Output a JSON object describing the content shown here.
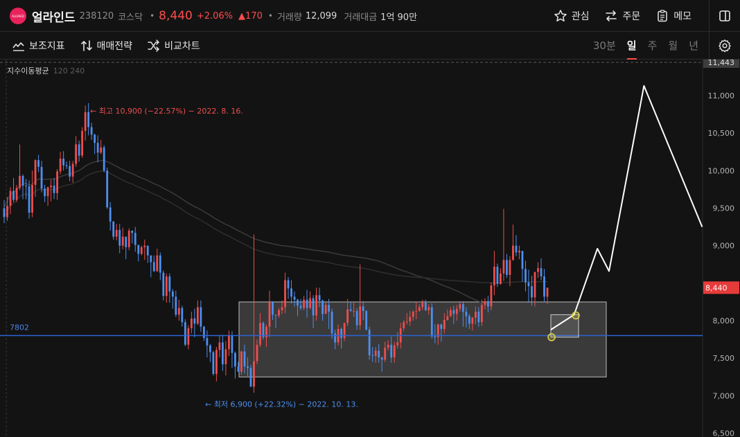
{
  "header": {
    "logo_text": "ALIGNED",
    "name": "얼라인드",
    "code": "238120",
    "market": "코스닥",
    "price": "8,440",
    "change_pct": "+2.06%",
    "change_abs": "▲170",
    "volume_label": "거래량",
    "volume": "12,099",
    "amount_label": "거래대금",
    "amount": "1억 90만",
    "buttons": {
      "watch": "관심",
      "order": "주문",
      "memo": "메모"
    }
  },
  "toolbar": {
    "tools": [
      "보조지표",
      "매매전략",
      "비교차트"
    ],
    "periods": [
      "30분",
      "일",
      "주",
      "월",
      "년"
    ],
    "active_period": "일"
  },
  "indicator": {
    "name": "지수이동평균",
    "params": "120 240"
  },
  "chart_data": {
    "type": "candlestick",
    "y_ticks": [
      "11,000",
      "10,500",
      "10,000",
      "9,500",
      "9,000",
      "8,000",
      "7,500",
      "7,000",
      "6,500"
    ],
    "ylim": [
      6450,
      11480
    ],
    "period_high": "11,443",
    "current_price": "8,440",
    "support_level": "7802",
    "annotation_high": "← 최고 10,900 (−22.57%) − 2022. 8. 16.",
    "annotation_low": "← 최저 6,900 (+22.32%) − 2022. 10. 13.",
    "box": {
      "top": 8250,
      "bottom": 7250
    },
    "projection_line": [
      [
        0,
        7880
      ],
      [
        4,
        8080
      ],
      [
        8,
        8960
      ],
      [
        10,
        8660
      ],
      [
        16,
        11130
      ],
      [
        26,
        9250
      ]
    ],
    "candles": [
      [
        9500,
        9380,
        9300,
        9610
      ],
      [
        9380,
        9530,
        9330,
        9650
      ],
      [
        9530,
        9730,
        9420,
        9780
      ],
      [
        9730,
        9610,
        9580,
        9900
      ],
      [
        9610,
        9770,
        9580,
        9810
      ],
      [
        9770,
        9930,
        9740,
        10350
      ],
      [
        9930,
        9800,
        9620,
        9950
      ],
      [
        9800,
        9790,
        9620,
        9890
      ],
      [
        9790,
        9440,
        9360,
        9870
      ],
      [
        9440,
        9810,
        9380,
        10000
      ],
      [
        9810,
        10140,
        9650,
        10150
      ],
      [
        10140,
        10050,
        9980,
        10210
      ],
      [
        10050,
        9760,
        9710,
        10130
      ],
      [
        9760,
        9660,
        9580,
        9810
      ],
      [
        9660,
        9780,
        9530,
        9780
      ],
      [
        9780,
        9800,
        9590,
        9880
      ],
      [
        9800,
        9700,
        9620,
        9900
      ],
      [
        9700,
        9990,
        9610,
        10020
      ],
      [
        9990,
        10160,
        9950,
        10250
      ],
      [
        10160,
        10070,
        10000,
        10260
      ],
      [
        10070,
        10060,
        10020,
        10120
      ],
      [
        10060,
        9920,
        9860,
        10130
      ],
      [
        9920,
        10090,
        9840,
        10130
      ],
      [
        10090,
        10350,
        10050,
        10460
      ],
      [
        10350,
        10200,
        10120,
        10400
      ],
      [
        10200,
        10530,
        10170,
        10580
      ],
      [
        10530,
        10780,
        10400,
        10870
      ],
      [
        10780,
        10580,
        10470,
        10900
      ],
      [
        10580,
        10480,
        10410,
        10640
      ],
      [
        10480,
        10370,
        10220,
        10490
      ],
      [
        10370,
        10240,
        10110,
        10470
      ],
      [
        10240,
        10310,
        10220,
        10410
      ],
      [
        10310,
        10000,
        9980,
        10340
      ],
      [
        10000,
        9510,
        9490,
        10040
      ],
      [
        9510,
        9320,
        9200,
        9580
      ],
      [
        9320,
        9120,
        9080,
        9330
      ],
      [
        9120,
        9210,
        9070,
        9290
      ],
      [
        9210,
        9000,
        8900,
        9290
      ],
      [
        9000,
        9120,
        8950,
        9240
      ],
      [
        9120,
        8980,
        8820,
        9120
      ],
      [
        8980,
        9200,
        8940,
        9230
      ],
      [
        9200,
        9170,
        9030,
        9200
      ],
      [
        9170,
        9010,
        8920,
        9250
      ],
      [
        9010,
        8890,
        8790,
        9010
      ],
      [
        8890,
        8980,
        8870,
        9000
      ],
      [
        8980,
        9000,
        8810,
        9080
      ],
      [
        9000,
        8870,
        8770,
        9000
      ],
      [
        8870,
        8780,
        8580,
        8870
      ],
      [
        8780,
        8660,
        8650,
        8870
      ],
      [
        8660,
        8870,
        8650,
        8960
      ],
      [
        8870,
        8640,
        8540,
        8910
      ],
      [
        8640,
        8330,
        8270,
        8670
      ],
      [
        8330,
        8590,
        8240,
        8630
      ],
      [
        8590,
        8390,
        8240,
        8630
      ],
      [
        8390,
        8320,
        8160,
        8420
      ],
      [
        8320,
        8080,
        8050,
        8400
      ],
      [
        8080,
        8170,
        8000,
        8280
      ],
      [
        8170,
        7980,
        7920,
        8200
      ],
      [
        7980,
        7680,
        7660,
        8020
      ],
      [
        7680,
        7900,
        7620,
        7940
      ],
      [
        7900,
        8030,
        7830,
        8120
      ],
      [
        8030,
        7960,
        7780,
        8160
      ],
      [
        7960,
        8180,
        7940,
        8270
      ],
      [
        8180,
        7920,
        7850,
        8270
      ],
      [
        7920,
        7770,
        7730,
        7930
      ],
      [
        7770,
        7670,
        7510,
        7870
      ],
      [
        7670,
        7580,
        7450,
        7690
      ],
      [
        7580,
        7290,
        7270,
        7600
      ],
      [
        7290,
        7610,
        7190,
        7650
      ],
      [
        7610,
        7710,
        7510,
        7800
      ],
      [
        7710,
        7420,
        7330,
        7810
      ],
      [
        7420,
        7620,
        7270,
        7730
      ],
      [
        7620,
        7800,
        7530,
        7870
      ],
      [
        7800,
        7570,
        7370,
        7860
      ],
      [
        7570,
        7390,
        7230,
        7590
      ],
      [
        7390,
        7320,
        7320,
        7450
      ],
      [
        7320,
        7590,
        7280,
        7600
      ],
      [
        7590,
        7390,
        7300,
        7680
      ],
      [
        7390,
        7370,
        7260,
        7510
      ],
      [
        7370,
        7120,
        7120,
        7410
      ],
      [
        7120,
        7460,
        7040,
        9150
      ],
      [
        7460,
        7680,
        7420,
        7750
      ],
      [
        7680,
        7970,
        7650,
        8100
      ],
      [
        7970,
        7780,
        7750,
        7990
      ],
      [
        7780,
        7920,
        7650,
        7950
      ],
      [
        7920,
        8250,
        7780,
        8400
      ],
      [
        8250,
        8080,
        8010,
        8260
      ],
      [
        8080,
        8070,
        7900,
        8080
      ],
      [
        8070,
        8140,
        8040,
        8170
      ],
      [
        8140,
        8180,
        8090,
        8270
      ],
      [
        8180,
        8540,
        8100,
        8640
      ],
      [
        8540,
        8430,
        8290,
        8580
      ],
      [
        8430,
        8320,
        8230,
        8540
      ],
      [
        8320,
        8280,
        8190,
        8390
      ],
      [
        8280,
        8200,
        8060,
        8290
      ],
      [
        8200,
        8170,
        8140,
        8290
      ],
      [
        8170,
        8280,
        8140,
        8330
      ],
      [
        8280,
        8170,
        8040,
        8410
      ],
      [
        8170,
        8300,
        8150,
        8390
      ],
      [
        8300,
        8070,
        7900,
        8340
      ],
      [
        8070,
        8340,
        8000,
        8440
      ],
      [
        8340,
        8270,
        8180,
        8440
      ],
      [
        8270,
        8090,
        8000,
        8280
      ],
      [
        8090,
        8210,
        8090,
        8260
      ],
      [
        8210,
        8120,
        7890,
        8290
      ],
      [
        8120,
        7830,
        7760,
        8160
      ],
      [
        7830,
        7710,
        7620,
        7880
      ],
      [
        7710,
        7890,
        7670,
        7950
      ],
      [
        7890,
        7770,
        7630,
        7910
      ],
      [
        7770,
        7970,
        7730,
        7970
      ],
      [
        7970,
        8150,
        7930,
        8290
      ],
      [
        8150,
        8130,
        8120,
        8250
      ],
      [
        8130,
        8130,
        8050,
        8240
      ],
      [
        8130,
        7940,
        7880,
        8170
      ],
      [
        7940,
        8190,
        7880,
        8750
      ],
      [
        8190,
        8130,
        8010,
        8260
      ],
      [
        8130,
        7880,
        7870,
        8140
      ],
      [
        7880,
        7540,
        7480,
        7920
      ],
      [
        7540,
        7530,
        7450,
        7650
      ],
      [
        7530,
        7600,
        7440,
        7650
      ],
      [
        7600,
        7510,
        7440,
        7690
      ],
      [
        7510,
        7480,
        7320,
        7520
      ],
      [
        7480,
        7640,
        7450,
        7720
      ],
      [
        7640,
        7680,
        7600,
        7740
      ],
      [
        7680,
        7510,
        7440,
        7790
      ],
      [
        7510,
        7670,
        7440,
        7720
      ],
      [
        7670,
        7710,
        7630,
        7850
      ],
      [
        7710,
        7900,
        7630,
        7970
      ],
      [
        7900,
        7980,
        7860,
        8010
      ],
      [
        7980,
        7990,
        7950,
        8100
      ],
      [
        7990,
        8050,
        7930,
        8130
      ],
      [
        8050,
        8120,
        8000,
        8140
      ],
      [
        8120,
        8130,
        8020,
        8250
      ],
      [
        8130,
        8180,
        8120,
        8220
      ],
      [
        8180,
        8240,
        8140,
        8280
      ],
      [
        8240,
        8140,
        8130,
        8280
      ],
      [
        8140,
        8180,
        8080,
        8220
      ],
      [
        8180,
        7790,
        7760,
        8230
      ],
      [
        7790,
        7780,
        7700,
        7950
      ],
      [
        7780,
        7950,
        7680,
        7960
      ],
      [
        7950,
        7890,
        7720,
        7960
      ],
      [
        7890,
        8010,
        7830,
        8100
      ],
      [
        8010,
        8060,
        8000,
        8150
      ],
      [
        8060,
        8140,
        8050,
        8180
      ],
      [
        8140,
        8090,
        7960,
        8200
      ],
      [
        8090,
        8160,
        8000,
        8210
      ],
      [
        8160,
        8220,
        8120,
        8260
      ],
      [
        8220,
        8120,
        7920,
        8260
      ],
      [
        8120,
        8060,
        7910,
        8180
      ],
      [
        8060,
        7960,
        7890,
        8090
      ],
      [
        7960,
        8040,
        7870,
        8050
      ],
      [
        8040,
        8120,
        7950,
        8190
      ],
      [
        8120,
        7980,
        7920,
        8180
      ],
      [
        7980,
        8210,
        7930,
        8280
      ],
      [
        8210,
        8260,
        8150,
        8300
      ],
      [
        8260,
        8190,
        8110,
        8330
      ],
      [
        8190,
        8470,
        8140,
        8510
      ],
      [
        8470,
        8720,
        8340,
        8930
      ],
      [
        8720,
        8490,
        8450,
        8760
      ],
      [
        8490,
        8630,
        8480,
        8700
      ],
      [
        8630,
        8810,
        8530,
        9490
      ],
      [
        8810,
        8610,
        8570,
        8890
      ],
      [
        8610,
        8810,
        8460,
        8860
      ],
      [
        8810,
        9000,
        8800,
        9280
      ],
      [
        9000,
        8910,
        8860,
        9140
      ],
      [
        8910,
        8930,
        8820,
        9000
      ],
      [
        8930,
        8690,
        8520,
        8930
      ],
      [
        8690,
        8510,
        8390,
        8800
      ],
      [
        8510,
        8460,
        8240,
        8680
      ],
      [
        8460,
        8310,
        8200,
        8600
      ],
      [
        8310,
        8650,
        8190,
        8650
      ],
      [
        8650,
        8700,
        8570,
        8780
      ],
      [
        8700,
        8590,
        8540,
        8830
      ],
      [
        8590,
        8320,
        8250,
        8690
      ],
      [
        8320,
        8440,
        8220,
        8440
      ]
    ]
  }
}
